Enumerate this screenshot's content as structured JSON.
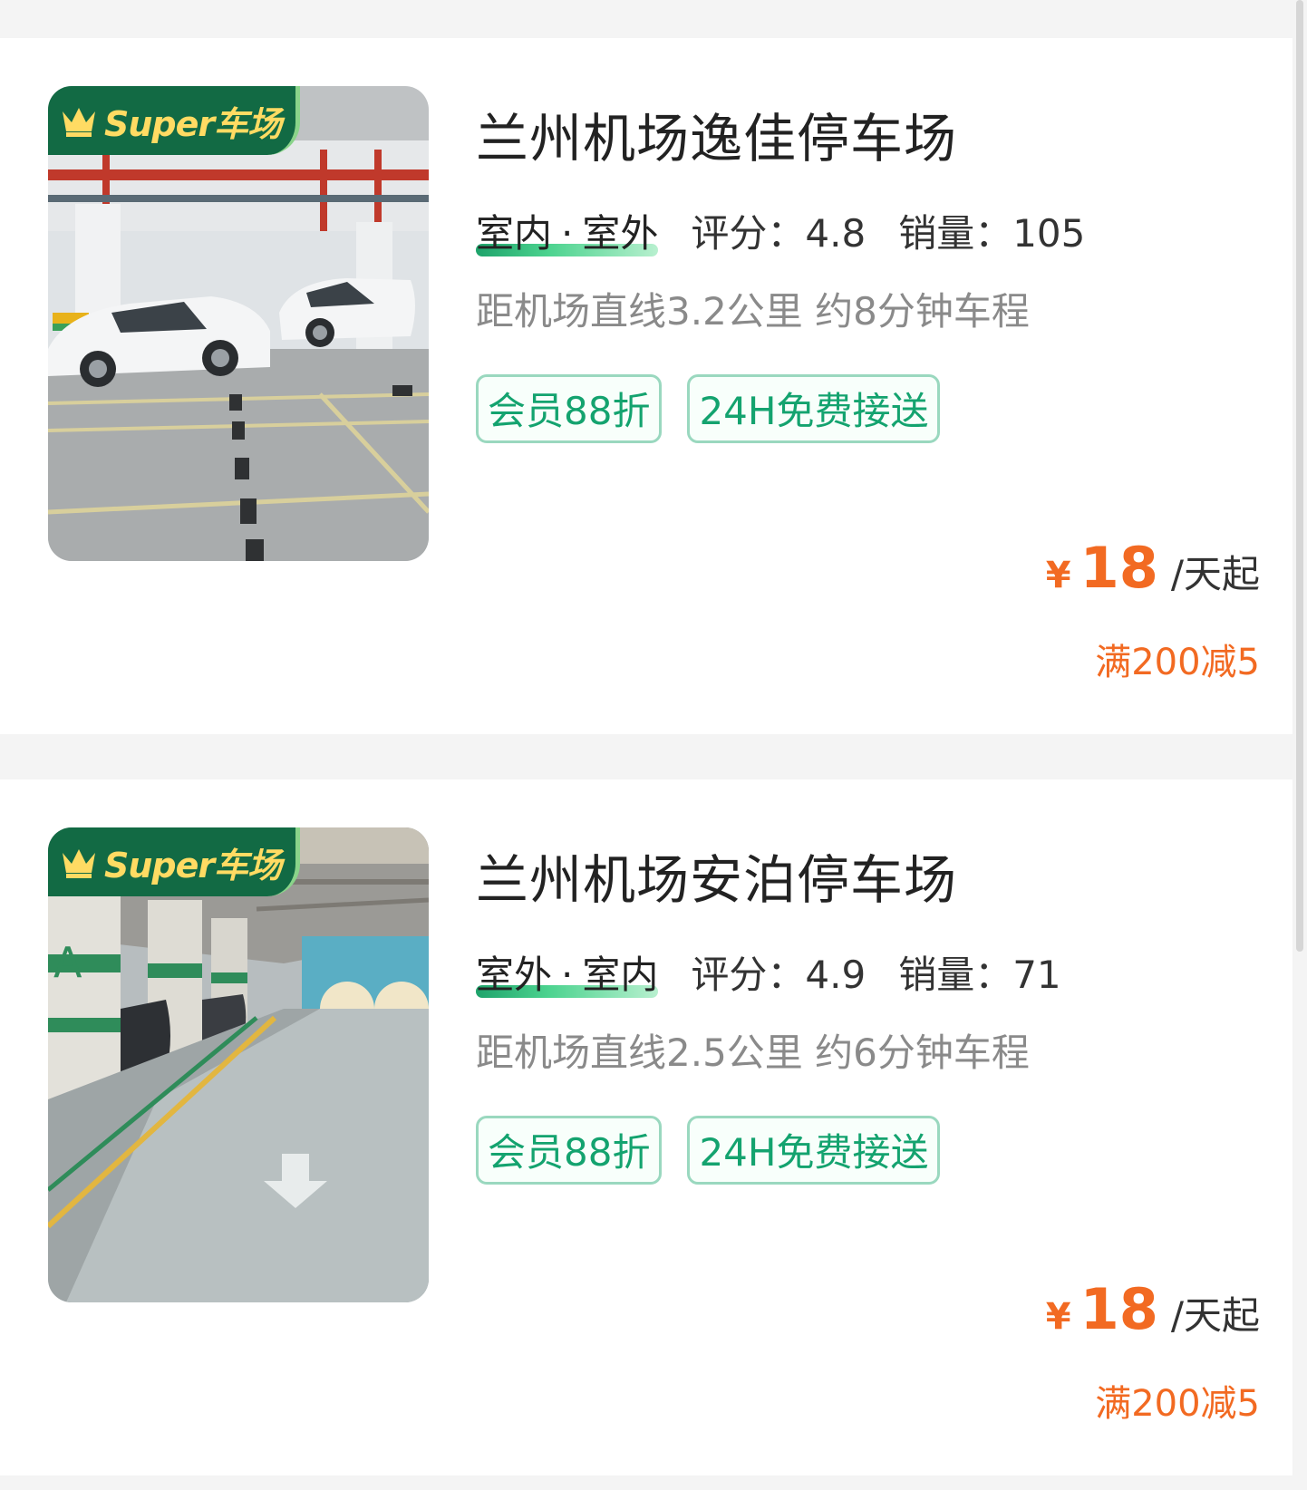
{
  "badge_text": "Super车场",
  "currency_symbol": "¥",
  "accent_color": "#f26a22",
  "brand_green": "#126a44",
  "tag_color": "#14a36f",
  "listings": [
    {
      "name": "兰州机场逸佳停车场",
      "type_a": "室内",
      "type_sep": "·",
      "type_b": "室外",
      "score_label": "评分：4.8",
      "sales_label": "销量：105",
      "distance": "距机场直线3.2公里 约8分钟车程",
      "tags": [
        "会员88折",
        "24H免费接送"
      ],
      "price": "18",
      "price_unit": "/天起",
      "discount": "满200减5"
    },
    {
      "name": "兰州机场安泊停车场",
      "type_a": "室外",
      "type_sep": "·",
      "type_b": "室内",
      "score_label": "评分：4.9",
      "sales_label": "销量：71",
      "distance": "距机场直线2.5公里 约6分钟车程",
      "tags": [
        "会员88折",
        "24H免费接送"
      ],
      "price": "18",
      "price_unit": "/天起",
      "discount": "满200减5"
    }
  ]
}
